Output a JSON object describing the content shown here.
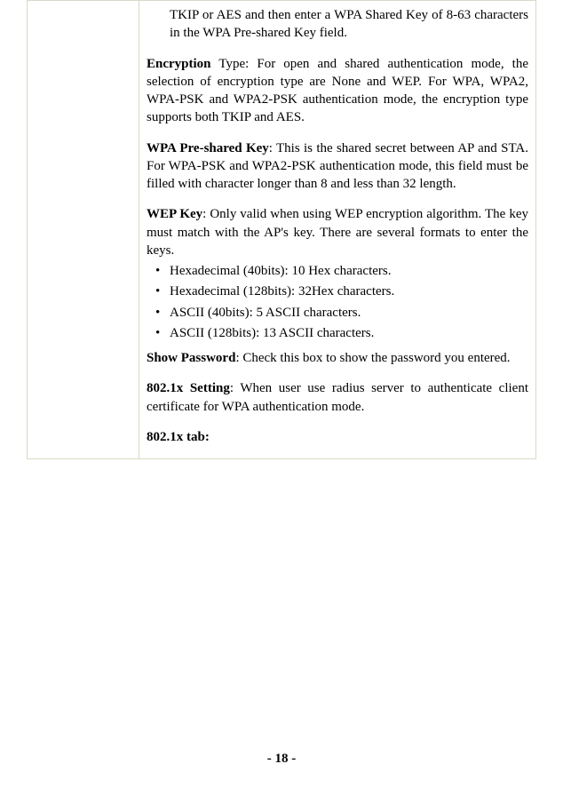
{
  "intro": "TKIP or AES and then enter a WPA Shared Key of 8-63 characters in the WPA Pre-shared Key field.",
  "encryption": {
    "label": "Encryption",
    "text": " Type: For open and shared authentication mode, the selection of encryption type are None and WEP. For WPA, WPA2, WPA-PSK and WPA2-PSK authentication mode, the encryption type supports both TKIP and AES."
  },
  "wpa_psk": {
    "label": "WPA Pre-shared Key",
    "text": ": This is the shared secret between AP and STA. For WPA-PSK and WPA2-PSK authentication mode, this field must be filled with character longer than 8 and less than 32 length."
  },
  "wep": {
    "label": "WEP Key",
    "text": ": Only valid when using WEP encryption algorithm. The key must match with the AP's key. There are several formats to enter the keys."
  },
  "bullets": [
    "Hexadecimal (40bits): 10 Hex characters.",
    "Hexadecimal (128bits): 32Hex characters.",
    "ASCII (40bits): 5 ASCII characters.",
    "ASCII (128bits): 13 ASCII characters."
  ],
  "show_pwd": {
    "label": "Show Password",
    "text": ": Check this box to show the password you entered."
  },
  "dot1x": {
    "label": "802.1x Setting",
    "text": ": When user use radius server to authenticate client certificate for WPA authentication mode."
  },
  "dot1x_tab": "802.1x tab:",
  "page_number": "- 18 -"
}
